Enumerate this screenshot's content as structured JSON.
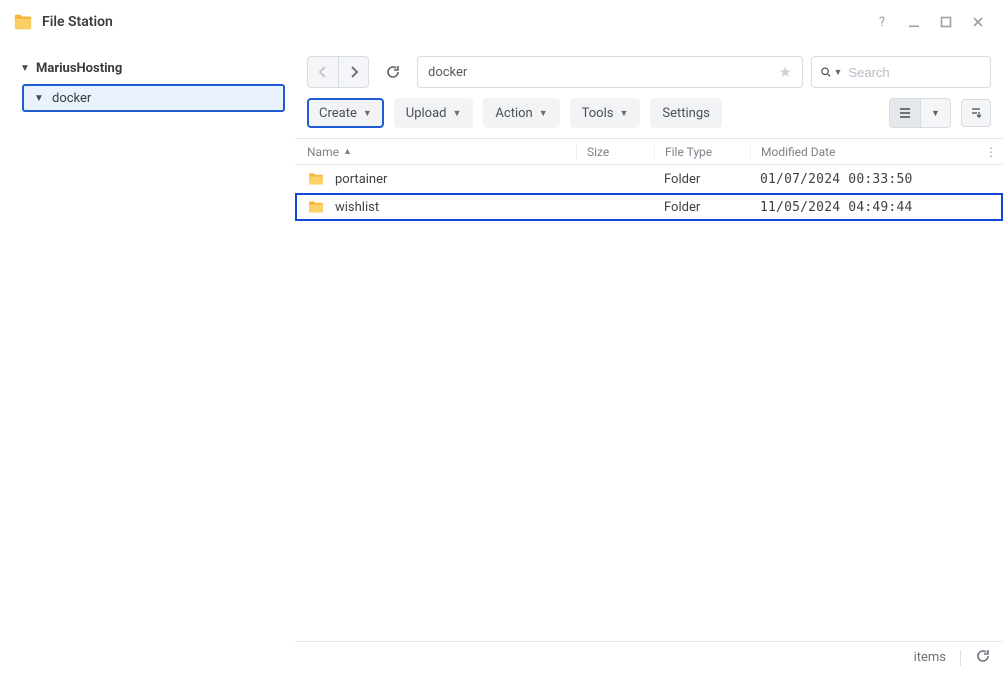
{
  "app": {
    "title": "File Station"
  },
  "sidebar": {
    "root_label": "MariusHosting",
    "child_label": "docker"
  },
  "nav": {
    "breadcrumb_text": "docker"
  },
  "search": {
    "placeholder": "Search"
  },
  "toolbar": {
    "create_label": "Create",
    "upload_label": "Upload",
    "action_label": "Action",
    "tools_label": "Tools",
    "settings_label": "Settings"
  },
  "columns": {
    "name": "Name",
    "size": "Size",
    "type": "File Type",
    "date": "Modified Date"
  },
  "rows": [
    {
      "name": "portainer",
      "size": "",
      "type": "Folder",
      "date": "01/07/2024 00:33:50",
      "highlight": false
    },
    {
      "name": "wishlist",
      "size": "",
      "type": "Folder",
      "date": "11/05/2024 04:49:44",
      "highlight": true
    }
  ],
  "status": {
    "items_label": "items"
  }
}
